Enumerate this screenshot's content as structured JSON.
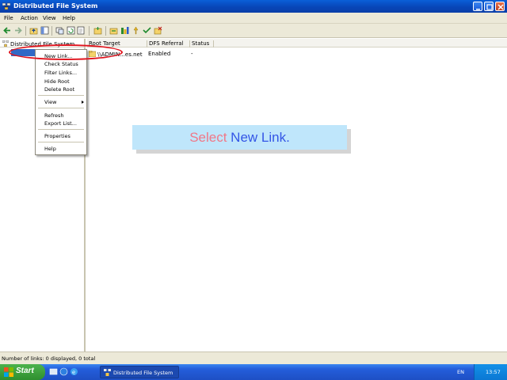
{
  "window": {
    "title": "Distributed File System"
  },
  "menu": {
    "file": "File",
    "action": "Action",
    "view": "View",
    "help": "Help"
  },
  "toolbar": {
    "icons": [
      "back-icon",
      "forward-icon",
      "up-icon",
      "show-hide-tree-icon",
      "new-window-icon",
      "refresh-icon",
      "export-icon",
      "new-root-icon",
      "filter-icon",
      "help-icon",
      "new-link-icon"
    ]
  },
  "tree": {
    "root_label": "Distributed File System"
  },
  "list": {
    "columns": [
      "Root Target",
      "DFS Referral",
      "Status"
    ],
    "rows": [
      {
        "root_target": "\\\\ADMIN...es.net",
        "dfs_referral": "Enabled",
        "status": "-"
      }
    ]
  },
  "context_menu": {
    "new_link": "New Link...",
    "check_status": "Check Status",
    "filter_links": "Filter Links...",
    "hide_root": "Hide Root",
    "delete_root": "Delete Root",
    "view": "View",
    "refresh": "Refresh",
    "export_list": "Export List...",
    "properties": "Properties",
    "help": "Help"
  },
  "banner": {
    "pre": "Select",
    "post": "New Link."
  },
  "statusbar": {
    "text": "Number of links: 0 displayed, 0 total"
  },
  "taskbar": {
    "start": "Start",
    "task": "Distributed File System",
    "language": "EN",
    "clock": "13:57"
  },
  "colors": {
    "titlebar": "#0a4fc4",
    "highlight": "#e0141e",
    "banner_bg": "#bfe6fb",
    "banner_pre": "#f07888",
    "banner_post": "#3456e6"
  }
}
